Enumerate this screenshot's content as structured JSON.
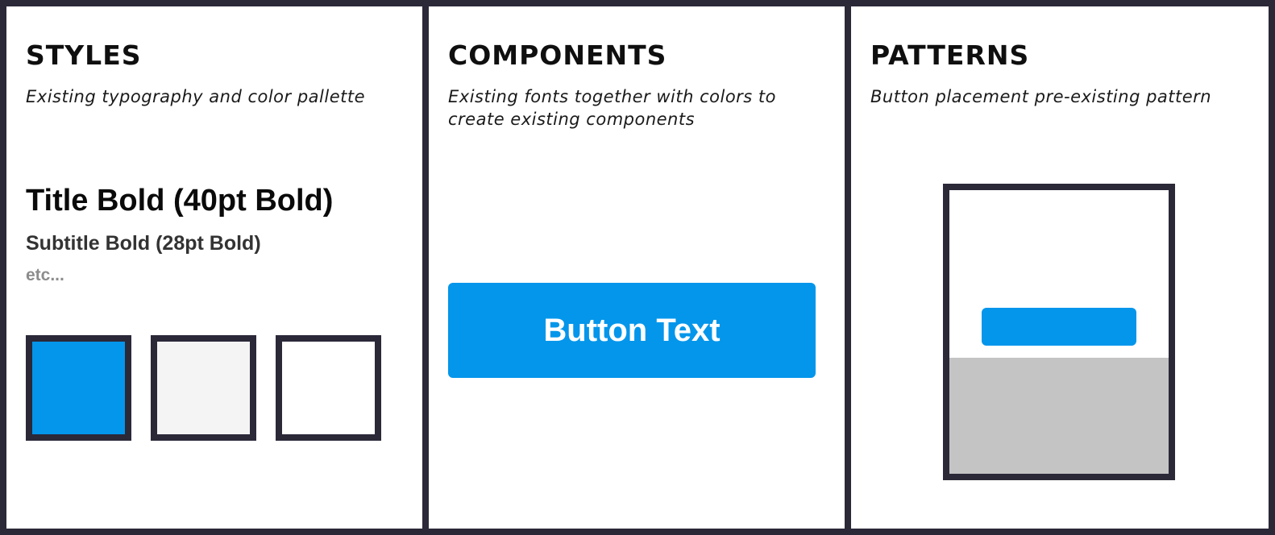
{
  "colors": {
    "frame": "#2b2838",
    "primary_blue": "#0396eb",
    "light_gray": "#f4f4f4",
    "white": "#ffffff",
    "pattern_gray": "#c4c4c4"
  },
  "styles": {
    "heading": "STYLES",
    "description": "Existing typography and color pallette",
    "title_sample": "Title Bold (40pt Bold)",
    "subtitle_sample": "Subtitle Bold (28pt Bold)",
    "etc": "etc..."
  },
  "components": {
    "heading": "COMPONENTS",
    "description": "Existing fonts together with colors to create existing components",
    "button_label": "Button Text"
  },
  "patterns": {
    "heading": "PATTERNS",
    "description": "Button placement pre-existing pattern"
  }
}
